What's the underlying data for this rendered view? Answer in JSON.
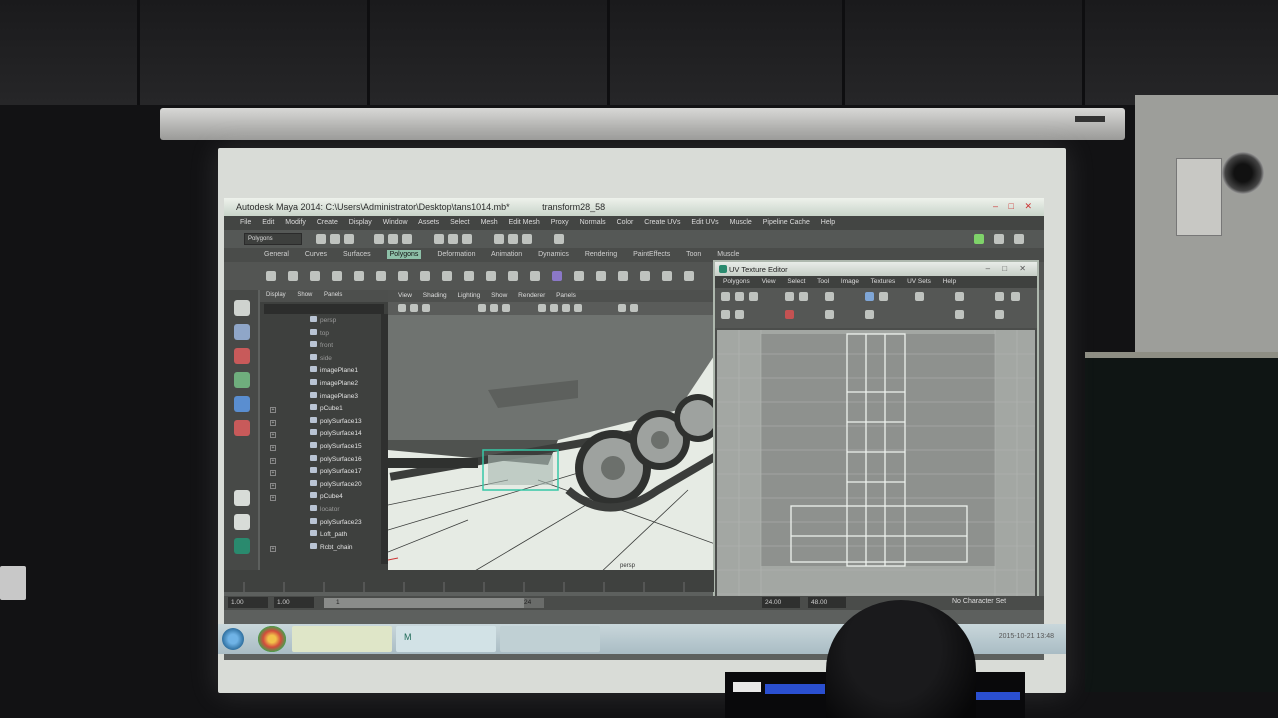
{
  "window": {
    "title": "Autodesk Maya 2014: C:\\Users\\Administrator\\Desktop\\tans1014.mb*",
    "title_extra": "transform28_58",
    "controls": "– □ ✕"
  },
  "menubar": [
    "File",
    "Edit",
    "Modify",
    "Create",
    "Display",
    "Window",
    "Assets",
    "Select",
    "Mesh",
    "Edit Mesh",
    "Proxy",
    "Normals",
    "Color",
    "Create UVs",
    "Edit UVs",
    "Muscle",
    "Pipeline Cache",
    "Help"
  ],
  "statusline": {
    "mode": "Polygons"
  },
  "shelf_tabs": [
    "General",
    "Curves",
    "Surfaces",
    "Polygons",
    "Deformation",
    "Animation",
    "Dynamics",
    "Rendering",
    "PaintEffects",
    "Toon",
    "Muscle"
  ],
  "active_shelf_tab": "Polygons",
  "outliner": {
    "menu": [
      "Display",
      "Show",
      "Panels"
    ],
    "items": [
      {
        "label": "persp",
        "dim": true,
        "expander": false
      },
      {
        "label": "top",
        "dim": true,
        "expander": false
      },
      {
        "label": "front",
        "dim": true,
        "expander": false
      },
      {
        "label": "side",
        "dim": true,
        "expander": false
      },
      {
        "label": "imagePlane1",
        "dim": false,
        "expander": false
      },
      {
        "label": "imagePlane2",
        "dim": false,
        "expander": false
      },
      {
        "label": "imagePlane3",
        "dim": false,
        "expander": false
      },
      {
        "label": "pCube1",
        "dim": false,
        "expander": true
      },
      {
        "label": "polySurface13",
        "dim": false,
        "expander": true
      },
      {
        "label": "polySurface14",
        "dim": false,
        "expander": true
      },
      {
        "label": "polySurface15",
        "dim": false,
        "expander": true
      },
      {
        "label": "polySurface16",
        "dim": false,
        "expander": true
      },
      {
        "label": "polySurface17",
        "dim": false,
        "expander": true
      },
      {
        "label": "polySurface20",
        "dim": false,
        "expander": true
      },
      {
        "label": "pCube4",
        "dim": false,
        "expander": true
      },
      {
        "label": "locator",
        "dim": true,
        "expander": false
      },
      {
        "label": "polySurface23",
        "dim": false,
        "expander": false
      },
      {
        "label": "Loft_path",
        "dim": false,
        "expander": false
      },
      {
        "label": "Rcbt_chain",
        "dim": false,
        "expander": true
      }
    ]
  },
  "viewport": {
    "menu": [
      "View",
      "Shading",
      "Lighting",
      "Show",
      "Renderer",
      "Panels"
    ],
    "camera_label": "persp",
    "colors": {
      "bg": "#e6ebe4",
      "body": "#6f7370",
      "track": "#3b3d3b",
      "wheel": "#9ea29f",
      "selection": "#37c7a6"
    }
  },
  "uv_editor": {
    "title": "UV Texture Editor",
    "controls": "– □ ✕",
    "menu": [
      "Polygons",
      "View",
      "Select",
      "Tool",
      "Image",
      "Textures",
      "UV Sets",
      "Help"
    ]
  },
  "timeline": {
    "start_field": "1.00",
    "start_field2": "1.00",
    "current_frame": "1",
    "slider_value": "24",
    "end_field": "24.00",
    "end_field2": "48.00",
    "character_set": "No Character Set"
  },
  "taskbar": {
    "clock": "2015-10-21 13:48"
  }
}
